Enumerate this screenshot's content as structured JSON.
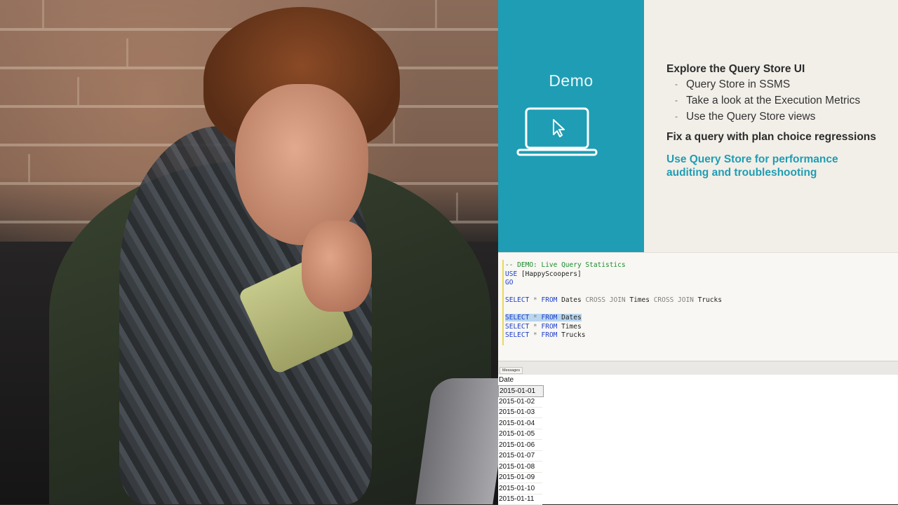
{
  "slide": {
    "demo_label": "Demo",
    "section1_title": "Explore the Query Store UI",
    "section1_bullets": [
      "Query Store in SSMS",
      "Take a look at the Execution Metrics",
      "Use the Query Store views"
    ],
    "section2_title": "Fix a query with plan choice regressions",
    "highlight_line1": "Use Query Store for performance",
    "highlight_line2": "auditing and troubleshooting",
    "colors": {
      "teal": "#1f9db4",
      "background": "#f2efe8",
      "highlight": "#1f9db4"
    }
  },
  "editor": {
    "comment": "-- DEMO: Live Query Statistics",
    "use_kw": "USE",
    "use_db": " [HappyScoopers]",
    "go_kw": "GO",
    "cross": {
      "select": "SELECT",
      "star": " * ",
      "from": "FROM",
      "t1": " Dates ",
      "cj1": "CROSS JOIN",
      "t2": " Times ",
      "cj2": "CROSS JOIN",
      "t3": " Trucks"
    },
    "q1": {
      "select": "SELECT",
      "star": " * ",
      "from": "FROM",
      "table": " Dates"
    },
    "q2": {
      "select": "SELECT",
      "star": " * ",
      "from": "FROM",
      "table": " Times"
    },
    "q3": {
      "select": "SELECT",
      "star": " * ",
      "from": "FROM",
      "table": " Trucks"
    }
  },
  "results": {
    "tab_label": "Messages",
    "column_header": "Date",
    "rows": [
      "2015-01-01",
      "2015-01-02",
      "2015-01-03",
      "2015-01-04",
      "2015-01-05",
      "2015-01-06",
      "2015-01-07",
      "2015-01-08",
      "2015-01-09",
      "2015-01-10",
      "2015-01-11"
    ]
  }
}
